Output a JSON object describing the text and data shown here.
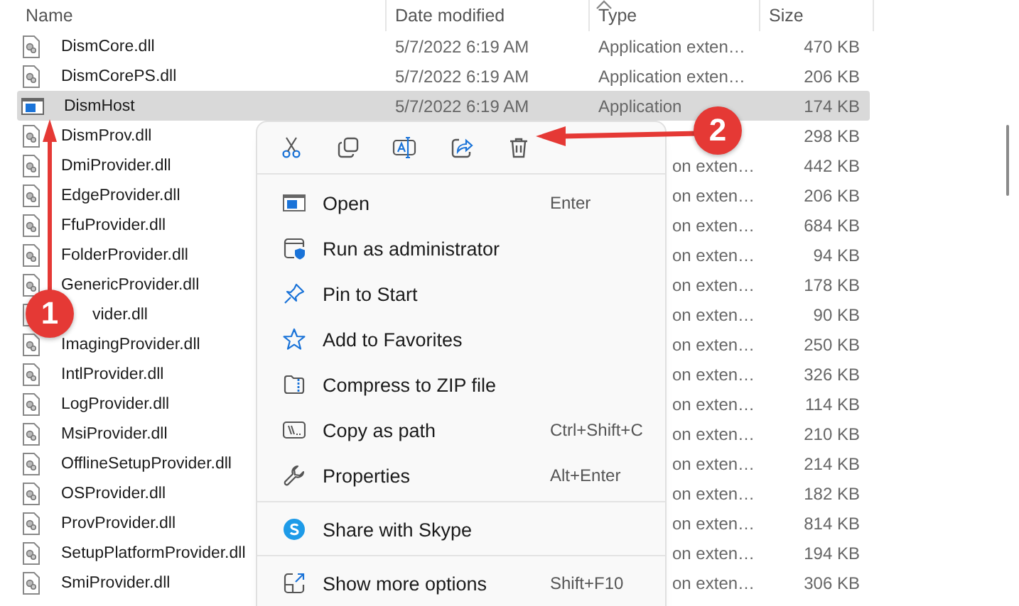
{
  "columns": [
    {
      "label": "Name"
    },
    {
      "label": "Date modified"
    },
    {
      "label": "Type"
    },
    {
      "label": "Size"
    }
  ],
  "rows": [
    {
      "name": "DismCore.dll",
      "kind": "dll",
      "date": "5/7/2022 6:19 AM",
      "type": "Application exten…",
      "size": "470 KB",
      "selected": false
    },
    {
      "name": "DismCorePS.dll",
      "kind": "dll",
      "date": "5/7/2022 6:19 AM",
      "type": "Application exten…",
      "size": "206 KB",
      "selected": false
    },
    {
      "name": "DismHost",
      "kind": "app",
      "date": "5/7/2022 6:19 AM",
      "type": "Application",
      "size": "174 KB",
      "selected": true
    },
    {
      "name": "DismProv.dll",
      "kind": "dll",
      "size": "298 KB",
      "selected": false
    },
    {
      "name": "DmiProvider.dll",
      "kind": "dll",
      "type": "on exten…",
      "size": "442 KB",
      "selected": false
    },
    {
      "name": "EdgeProvider.dll",
      "kind": "dll",
      "type": "on exten…",
      "size": "206 KB",
      "selected": false
    },
    {
      "name": "FfuProvider.dll",
      "kind": "dll",
      "type": "on exten…",
      "size": "684 KB",
      "selected": false
    },
    {
      "name": "FolderProvider.dll",
      "kind": "dll",
      "type": "on exten…",
      "size": "94 KB",
      "selected": false
    },
    {
      "name": "GenericProvider.dll",
      "kind": "dll",
      "type": "on exten…",
      "size": "178 KB",
      "selected": false
    },
    {
      "name": "vider.dll",
      "kind": "dll",
      "covered": true,
      "type": "on exten…",
      "size": "90 KB",
      "selected": false
    },
    {
      "name": "ImagingProvider.dll",
      "kind": "dll",
      "type": "on exten…",
      "size": "250 KB",
      "selected": false
    },
    {
      "name": "IntlProvider.dll",
      "kind": "dll",
      "type": "on exten…",
      "size": "326 KB",
      "selected": false
    },
    {
      "name": "LogProvider.dll",
      "kind": "dll",
      "type": "on exten…",
      "size": "114 KB",
      "selected": false
    },
    {
      "name": "MsiProvider.dll",
      "kind": "dll",
      "type": "on exten…",
      "size": "210 KB",
      "selected": false
    },
    {
      "name": "OfflineSetupProvider.dll",
      "kind": "dll",
      "type": "on exten…",
      "size": "214 KB",
      "selected": false
    },
    {
      "name": "OSProvider.dll",
      "kind": "dll",
      "type": "on exten…",
      "size": "182 KB",
      "selected": false
    },
    {
      "name": "ProvProvider.dll",
      "kind": "dll",
      "type": "on exten…",
      "size": "814 KB",
      "selected": false
    },
    {
      "name": "SetupPlatformProvider.dll",
      "kind": "dll",
      "type": "on exten…",
      "size": "194 KB",
      "selected": false
    },
    {
      "name": "SmiProvider.dll",
      "kind": "dll",
      "type": "on exten…",
      "size": "306 KB",
      "selected": false
    }
  ],
  "context_menu": {
    "toolbar": [
      {
        "kind": "cut"
      },
      {
        "kind": "copy"
      },
      {
        "kind": "rename"
      },
      {
        "kind": "share"
      },
      {
        "kind": "delete"
      }
    ],
    "items": [
      {
        "kind": "open",
        "label": "Open",
        "shortcut": "Enter"
      },
      {
        "kind": "admin",
        "label": "Run as administrator"
      },
      {
        "kind": "pin",
        "label": "Pin to Start"
      },
      {
        "kind": "star",
        "label": "Add to Favorites"
      },
      {
        "kind": "zip",
        "label": "Compress to ZIP file"
      },
      {
        "kind": "path",
        "label": "Copy as path",
        "shortcut": "Ctrl+Shift+C"
      },
      {
        "kind": "wrench",
        "label": "Properties",
        "shortcut": "Alt+Enter"
      },
      {
        "kind": "separator"
      },
      {
        "kind": "skype",
        "label": "Share with Skype"
      },
      {
        "kind": "separator"
      },
      {
        "kind": "more",
        "label": "Show more options",
        "shortcut": "Shift+F10"
      }
    ]
  },
  "annotations": [
    {
      "kind": "arrow-up",
      "number": "1"
    },
    {
      "kind": "arrow-left",
      "number": "2"
    }
  ]
}
